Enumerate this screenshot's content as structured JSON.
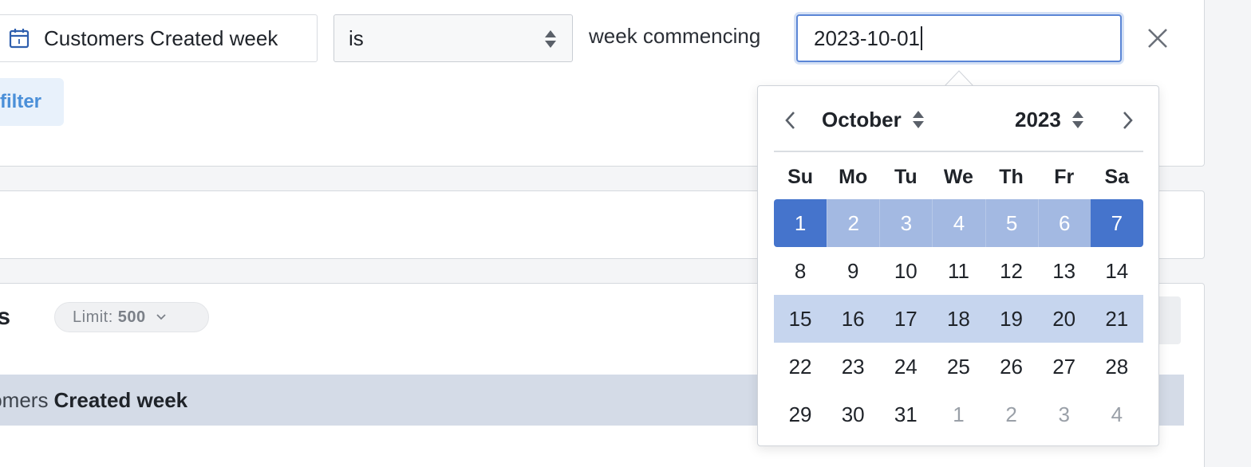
{
  "filter": {
    "dimension_label": "Customers Created week",
    "operator_value": "is",
    "connector_label": "week commencing",
    "date_value": "2023-10-01",
    "add_filter_label": "filter"
  },
  "sections": {
    "dimensions_title": "ts",
    "results_title": "lts",
    "limit_label": "Limit:",
    "limit_value": "500"
  },
  "table": {
    "header_prefix": "stomers",
    "header_bold": "Created week"
  },
  "datepicker": {
    "month": "October",
    "year": "2023",
    "weekdays": [
      "Su",
      "Mo",
      "Tu",
      "We",
      "Th",
      "Fr",
      "Sa"
    ],
    "weeks": [
      [
        "1",
        "2",
        "3",
        "4",
        "5",
        "6",
        "7"
      ],
      [
        "8",
        "9",
        "10",
        "11",
        "12",
        "13",
        "14"
      ],
      [
        "15",
        "16",
        "17",
        "18",
        "19",
        "20",
        "21"
      ],
      [
        "22",
        "23",
        "24",
        "25",
        "26",
        "27",
        "28"
      ],
      [
        "29",
        "30",
        "31",
        "1",
        "2",
        "3",
        "4"
      ]
    ],
    "selected_week": 0,
    "hover_week": 2,
    "outside_in_last_week_from": 3
  },
  "colors": {
    "accent": "#4574cc",
    "range": "#a3b9e2",
    "hover": "#c6d5ee",
    "focus_border": "#5b86d6",
    "link": "#4a8fd8"
  },
  "icons": {
    "dimension": "calendar-icon",
    "operator": "sort-arrows-icon",
    "clear": "close-icon",
    "prev": "chevron-left-icon",
    "next": "chevron-right-icon",
    "limit": "chevron-down-icon"
  }
}
